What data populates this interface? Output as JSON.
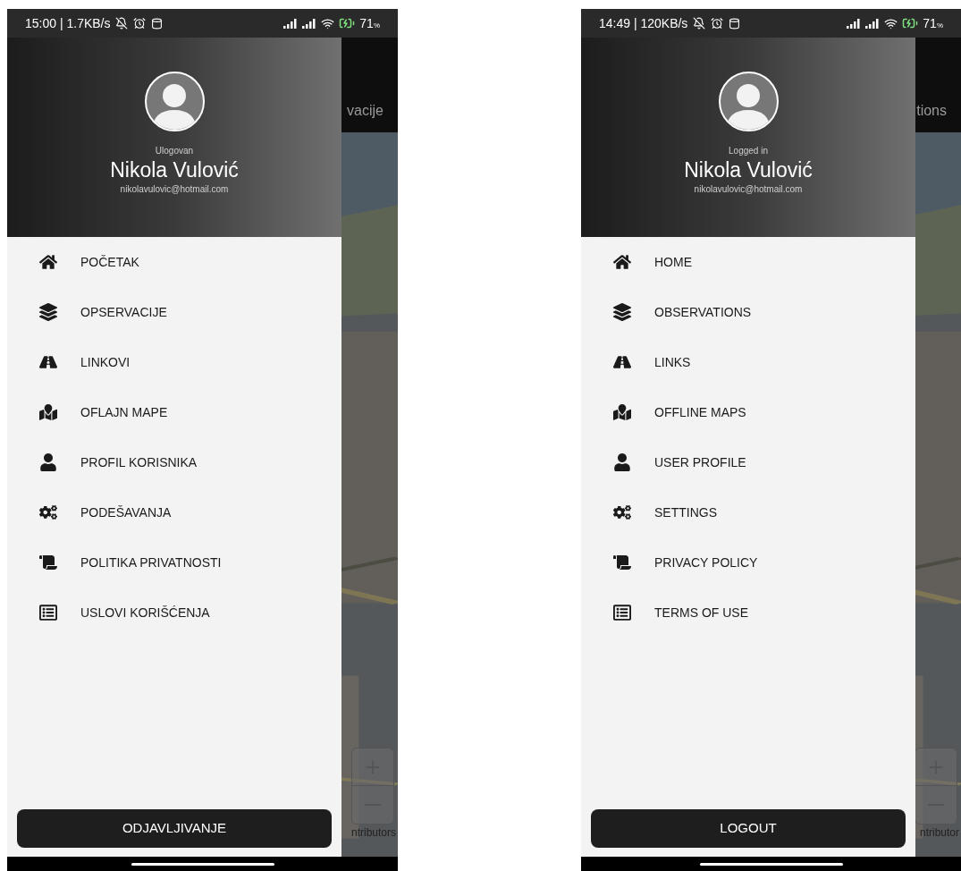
{
  "phones": [
    {
      "status_bar": {
        "time": "15:00 | 1.7KB/s",
        "battery": "71",
        "battery_unit": "%"
      },
      "app_bar_title": "vacije",
      "header": {
        "status": "Ulogovan",
        "name": "Nikola Vulović",
        "email": "nikolavulovic@hotmail.com"
      },
      "menu": [
        {
          "kind": "home",
          "label": "POČETAK"
        },
        {
          "kind": "layers",
          "label": "OPSERVACIJE"
        },
        {
          "kind": "road",
          "label": "LINKOVI"
        },
        {
          "kind": "map",
          "label": "OFLAJN MAPE"
        },
        {
          "kind": "user",
          "label": "PROFIL KORISNIKA"
        },
        {
          "kind": "gears",
          "label": "PODEŠAVANJA"
        },
        {
          "kind": "scroll",
          "label": "POLITIKA PRIVATNOSTI"
        },
        {
          "kind": "list",
          "label": "USLOVI KORIŠĆENJA"
        }
      ],
      "logout_button": "ODJAVLJIVANJE",
      "map_attribution": "ntributors"
    },
    {
      "status_bar": {
        "time": "14:49 | 120KB/s",
        "battery": "71",
        "battery_unit": "%"
      },
      "app_bar_title": "tions",
      "header": {
        "status": "Logged in",
        "name": "Nikola Vulović",
        "email": "nikolavulovic@hotmail.com"
      },
      "menu": [
        {
          "kind": "home",
          "label": "HOME"
        },
        {
          "kind": "layers",
          "label": "OBSERVATIONS"
        },
        {
          "kind": "road",
          "label": "LINKS"
        },
        {
          "kind": "map",
          "label": "OFFLINE MAPS"
        },
        {
          "kind": "user",
          "label": "USER PROFILE"
        },
        {
          "kind": "gears",
          "label": "SETTINGS"
        },
        {
          "kind": "scroll",
          "label": "PRIVACY POLICY"
        },
        {
          "kind": "list",
          "label": "TERMS OF USE"
        }
      ],
      "logout_button": "LOGOUT",
      "map_attribution": "ntributor"
    }
  ]
}
